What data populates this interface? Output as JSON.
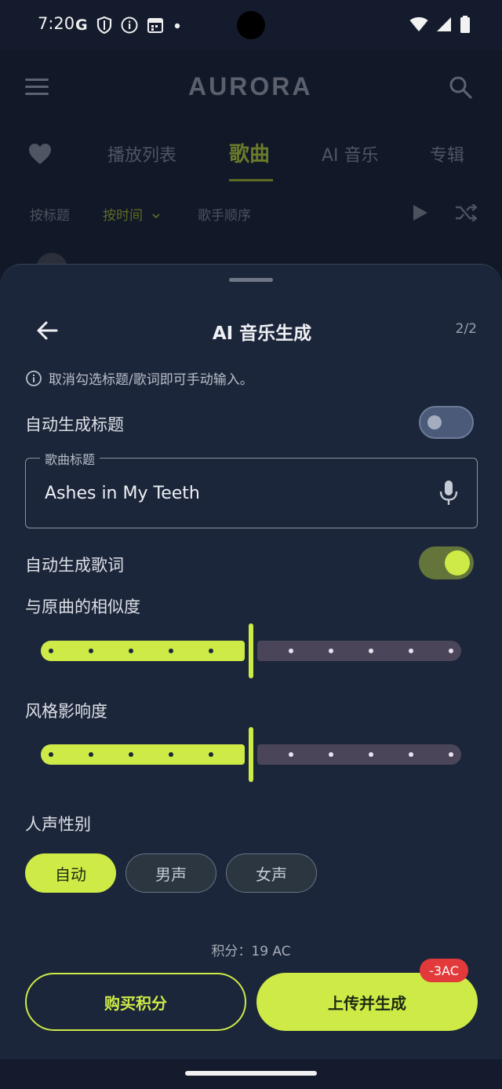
{
  "status_bar": {
    "time": "7:20",
    "left_icons": [
      "google-g-icon",
      "shield-icon",
      "info-icon",
      "calendar-icon",
      "dot-icon"
    ],
    "right_icons": [
      "wifi-icon",
      "signal-icon",
      "battery-icon"
    ],
    "g_glyph": "G"
  },
  "app_bar": {
    "logo": "AURORA",
    "menu_icon": "hamburger-menu-icon",
    "search_icon": "search-icon"
  },
  "tabs": [
    {
      "label": "播放列表",
      "active": false
    },
    {
      "label": "歌曲",
      "active": true
    },
    {
      "label": "AI 音乐",
      "active": false
    },
    {
      "label": "专辑",
      "active": false
    }
  ],
  "sort_options": [
    {
      "label": "按标题",
      "active": false
    },
    {
      "label": "按时间",
      "active": true
    },
    {
      "label": "歌手顺序",
      "active": false
    }
  ],
  "sheet": {
    "title": "AI 音乐生成",
    "step": "2/2",
    "hint": "取消勾选标题/歌词即可手动输入。",
    "auto_title_label": "自动生成标题",
    "auto_title_on": false,
    "song_title_label": "歌曲标题",
    "song_title_value": "Ashes in My Teeth",
    "auto_lyrics_label": "自动生成歌词",
    "auto_lyrics_on": true,
    "similarity_label": "与原曲的相似度",
    "similarity_value": 0.5,
    "style_label": "风格影响度",
    "style_value": 0.5,
    "vocal_label": "人声性别",
    "vocal_options": [
      "自动",
      "男声",
      "女声"
    ],
    "vocal_selected": "自动",
    "credits": "积分：19 AC",
    "buy_button": "购买积分",
    "generate_button": "上传并生成",
    "cost_badge": "-3AC"
  },
  "colors": {
    "accent": "#cdea47",
    "sheet_bg": "#1c263a",
    "badge": "#e23a3a"
  }
}
